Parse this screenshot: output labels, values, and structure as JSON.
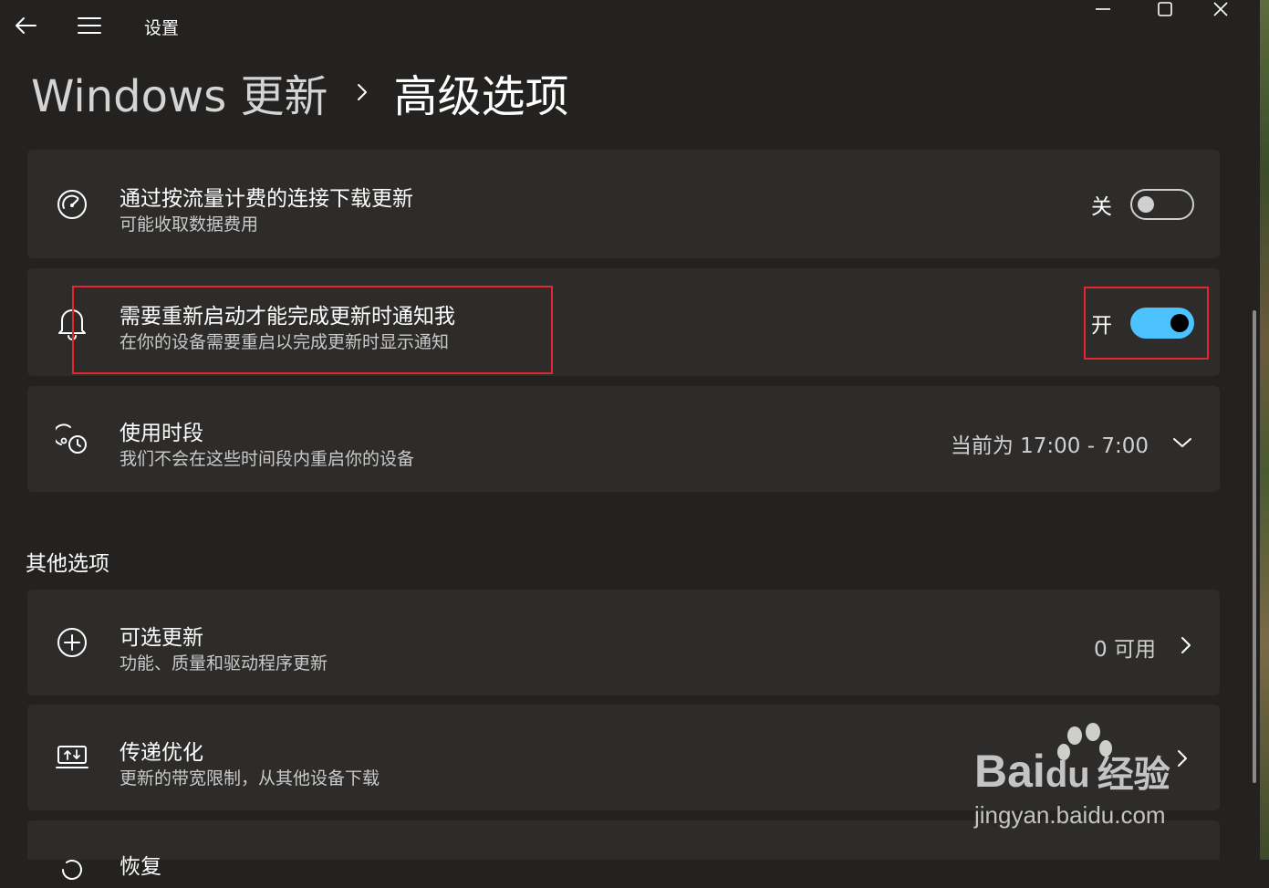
{
  "window": {
    "title": "设置",
    "back_icon": "back-arrow-icon",
    "menu_icon": "hamburger-menu-icon",
    "controls": [
      "minimize-icon",
      "maximize-icon",
      "close-icon"
    ]
  },
  "breadcrumb": {
    "parent": "Windows 更新",
    "separator_icon": "chevron-right-icon",
    "current": "高级选项"
  },
  "settings": [
    {
      "icon": "speedometer-icon",
      "title": "通过按流量计费的连接下载更新",
      "subtitle": "可能收取数据费用",
      "control": "toggle",
      "state_label": "关",
      "on": false
    },
    {
      "icon": "bell-icon",
      "title": "需要重新启动才能完成更新时通知我",
      "subtitle": "在你的设备需要重启以完成更新时显示通知",
      "control": "toggle",
      "state_label": "开",
      "on": true
    },
    {
      "icon": "active-hours-clock-icon",
      "title": "使用时段",
      "subtitle": "我们不会在这些时间段内重启你的设备",
      "control": "dropdown",
      "value": "当前为 17:00 - 7:00",
      "chevron_icon": "chevron-down-icon"
    }
  ],
  "other_options": {
    "heading": "其他选项",
    "items": [
      {
        "icon": "plus-circle-icon",
        "title": "可选更新",
        "subtitle": "功能、质量和驱动程序更新",
        "value": "0 可用",
        "chevron_icon": "chevron-right-icon"
      },
      {
        "icon": "delivery-optimization-icon",
        "title": "传递优化",
        "subtitle": "更新的带宽限制，从其他设备下载",
        "chevron_icon": "chevron-right-icon"
      },
      {
        "icon": "recovery-icon",
        "title": "恢复"
      }
    ]
  },
  "watermark": {
    "brand": "Bai",
    "brand_du": "du",
    "cn": "经验",
    "url": "jingyan.baidu.com"
  },
  "colors": {
    "background": "#232220",
    "card": "#2d2c2a",
    "accent": "#4cc2ff",
    "highlight": "#e3262f"
  }
}
